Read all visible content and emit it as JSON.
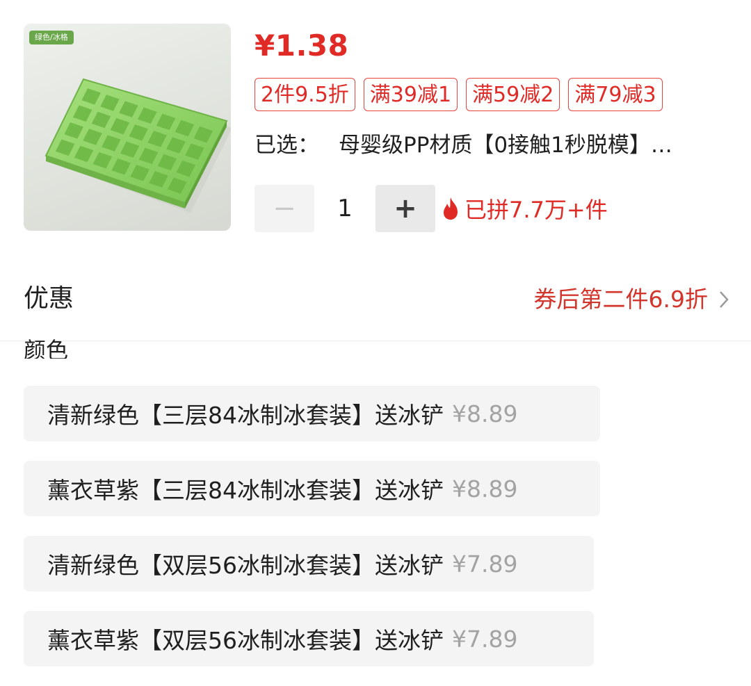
{
  "product": {
    "image_tag": "绿色/冰格",
    "image_icon": "ice-cube-tray-image",
    "price": "¥1.38",
    "promo_tags": [
      "2件9.5折",
      "满39减1",
      "满59减2",
      "满79减3"
    ],
    "selected_label": "已选：",
    "selected_value": "母婴级PP材质【0接触1秒脱模】…"
  },
  "quantity": {
    "minus": "−",
    "value": "1",
    "plus": "+",
    "sold_text": "已拼7.7万+件",
    "sold_icon": "fire-icon"
  },
  "promotion": {
    "title": "优惠",
    "value": "券后第二件6.9折",
    "chevron": "›"
  },
  "color_section": {
    "title": "颜色"
  },
  "options": [
    {
      "name": "清新绿色【三层84冰制冰套装】送冰铲",
      "price": "¥8.89"
    },
    {
      "name": "薰衣草紫【三层84冰制冰套装】送冰铲",
      "price": "¥8.89"
    },
    {
      "name": "清新绿色【双层56冰制冰套装】送冰铲",
      "price": "¥7.89"
    },
    {
      "name": "薰衣草紫【双层56冰制冰套装】送冰铲",
      "price": "¥7.89"
    }
  ],
  "colors": {
    "accent_red": "#e02a26",
    "tray_green": "#8fd46a",
    "muted_gray": "#a3a3a3"
  }
}
